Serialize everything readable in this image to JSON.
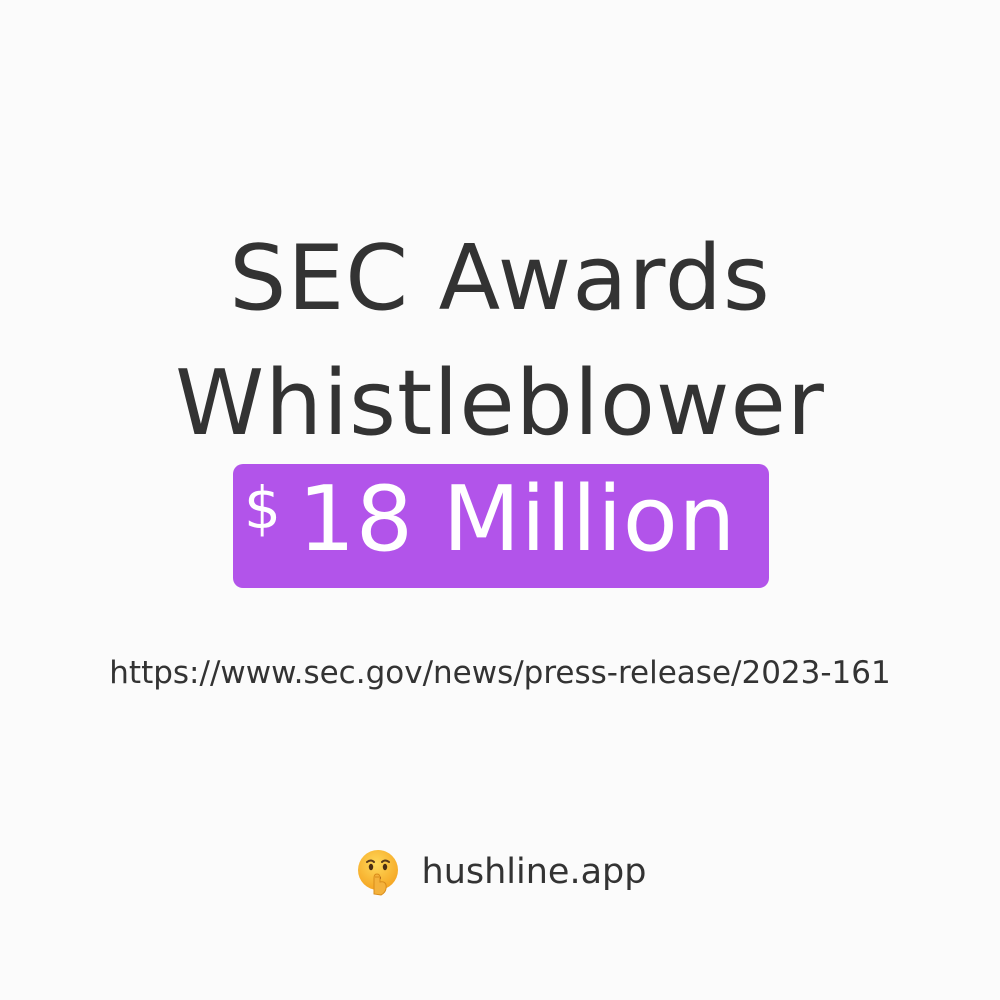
{
  "headline": {
    "line1": "SEC Awards",
    "line2": "Whistleblower"
  },
  "award": {
    "currency": "$",
    "amount": "18 Million",
    "highlight_color": "#b254ea"
  },
  "source": {
    "url": "https://www.sec.gov/news/press-release/2023-161"
  },
  "footer": {
    "icon": "shushing-face-icon",
    "brand": "hushline.app"
  },
  "colors": {
    "background": "#fbfbfb",
    "text": "#333333",
    "accent": "#b254ea"
  }
}
